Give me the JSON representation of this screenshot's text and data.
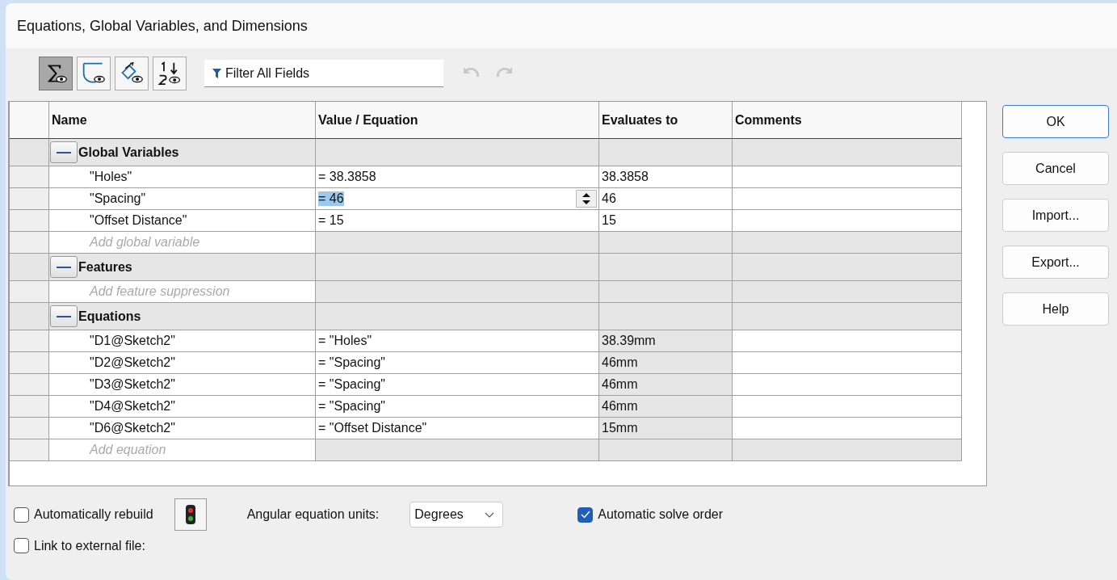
{
  "window": {
    "title": "Equations, Global Variables, and Dimensions"
  },
  "toolbar": {
    "views": [
      {
        "kind": "sigma",
        "selected": true
      },
      {
        "kind": "sketch",
        "selected": false
      },
      {
        "kind": "dimension",
        "selected": false
      },
      {
        "kind": "order",
        "selected": false
      }
    ],
    "filter": {
      "placeholder": "Filter All Fields"
    },
    "undo": {
      "disabled": true
    },
    "redo": {
      "disabled": true
    }
  },
  "table": {
    "columns": [
      "Name",
      "Value / Equation",
      "Evaluates to",
      "Comments"
    ],
    "sections": [
      {
        "title": "Global Variables",
        "expanded": true,
        "rows": [
          {
            "name": "\"Holes\"",
            "value": "= 38.3858",
            "evaluates": "38.3858",
            "computed": false,
            "editing": false
          },
          {
            "name": "\"Spacing\"",
            "value": "= 46",
            "evaluates": "46",
            "computed": false,
            "editing": true
          },
          {
            "name": "\"Offset Distance\"",
            "value": "= 15",
            "evaluates": "15",
            "computed": false,
            "editing": false
          }
        ],
        "add_placeholder": "Add global variable"
      },
      {
        "title": "Features",
        "expanded": true,
        "add_placeholder": "Add feature suppression"
      },
      {
        "title": "Equations",
        "expanded": true,
        "rows": [
          {
            "name": "\"D1@Sketch2\"",
            "value": "= \"Holes\"",
            "evaluates": "38.39mm",
            "computed": true,
            "editing": false
          },
          {
            "name": "\"D2@Sketch2\"",
            "value": "= \"Spacing\"",
            "evaluates": "46mm",
            "computed": true,
            "editing": false
          },
          {
            "name": "\"D3@Sketch2\"",
            "value": "= \"Spacing\"",
            "evaluates": "46mm",
            "computed": true,
            "editing": false
          },
          {
            "name": "\"D4@Sketch2\"",
            "value": "= \"Spacing\"",
            "evaluates": "46mm",
            "computed": true,
            "editing": false
          },
          {
            "name": "\"D6@Sketch2\"",
            "value": "= \"Offset Distance\"",
            "evaluates": "15mm",
            "computed": true,
            "editing": false
          }
        ],
        "add_placeholder": "Add equation"
      }
    ]
  },
  "buttons": [
    {
      "label": "OK",
      "default": true
    },
    {
      "label": "Cancel",
      "default": false
    },
    {
      "label": "Import...",
      "default": false
    },
    {
      "label": "Export...",
      "default": false
    },
    {
      "label": "Help",
      "default": false
    }
  ],
  "options": {
    "auto_rebuild": {
      "label": "Automatically rebuild",
      "checked": false
    },
    "angular_units": {
      "label": "Angular equation units:",
      "value": "Degrees"
    },
    "auto_solve": {
      "label": "Automatic solve order",
      "checked": true
    },
    "link_external": {
      "label": "Link to external file:",
      "checked": false
    }
  }
}
